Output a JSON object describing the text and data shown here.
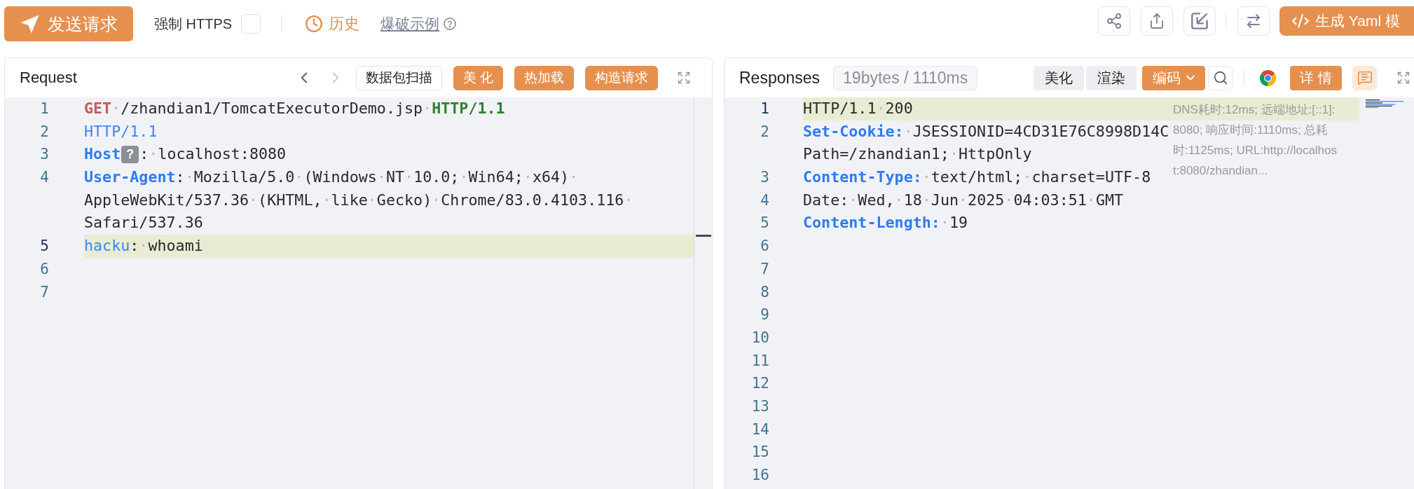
{
  "toolbar": {
    "send_button": {
      "label": "发送请求"
    },
    "force_https": {
      "label": "强制 HTTPS",
      "checked": false
    },
    "history_button": {
      "label": "历史"
    },
    "example_link": {
      "label": "爆破示例"
    },
    "generate_button": {
      "label": "生成 Yaml 模"
    }
  },
  "request": {
    "title": "Request",
    "nav": [
      {
        "kind": "prev",
        "disabled": false
      },
      {
        "kind": "next",
        "disabled": true
      }
    ],
    "buttons": [
      {
        "kind": "outline",
        "label": "数据包扫描"
      },
      {
        "kind": "primary",
        "label": "美 化"
      },
      {
        "kind": "primary",
        "label": "热加载"
      },
      {
        "kind": "primary",
        "label": "构造请求"
      }
    ],
    "lines": [
      {
        "number": "1",
        "active": false,
        "rows": [
          {
            "tokens": [
              {
                "kind": "method",
                "text": "GET"
              },
              {
                "kind": "space",
                "text": "·"
              },
              {
                "kind": "text",
                "text": "/zhandian1/TomcatExecutorDemo.jsp"
              },
              {
                "kind": "space",
                "text": "·"
              },
              {
                "kind": "version",
                "text": "HTTP/1.1"
              }
            ]
          }
        ]
      },
      {
        "number": "2",
        "active": false,
        "rows": [
          {
            "tokens": [
              {
                "kind": "protocol",
                "text": "HTTP/1.1"
              }
            ]
          }
        ]
      },
      {
        "number": "3",
        "active": false,
        "rows": [
          {
            "tokens": [
              {
                "kind": "header",
                "text": "Host"
              },
              {
                "kind": "hint",
                "text": "?"
              },
              {
                "kind": "text",
                "text": ":"
              },
              {
                "kind": "space",
                "text": "·"
              },
              {
                "kind": "text",
                "text": "localhost:8080"
              }
            ]
          }
        ]
      },
      {
        "number": "4",
        "active": false,
        "rows": [
          {
            "tokens": [
              {
                "kind": "header",
                "text": "User-Agent"
              },
              {
                "kind": "text",
                "text": ":"
              },
              {
                "kind": "space",
                "text": "·"
              },
              {
                "kind": "text",
                "text": "Mozilla/5.0"
              },
              {
                "kind": "space",
                "text": "·"
              },
              {
                "kind": "text",
                "text": "(Windows"
              },
              {
                "kind": "space",
                "text": "·"
              },
              {
                "kind": "text",
                "text": "NT"
              },
              {
                "kind": "space",
                "text": "·"
              },
              {
                "kind": "text",
                "text": "10.0;"
              },
              {
                "kind": "space",
                "text": "·"
              },
              {
                "kind": "text",
                "text": "Win64;"
              },
              {
                "kind": "space",
                "text": "·"
              },
              {
                "kind": "text",
                "text": "x64)"
              },
              {
                "kind": "space",
                "text": "·"
              }
            ]
          },
          {
            "tokens": [
              {
                "kind": "text",
                "text": "AppleWebKit/537.36"
              },
              {
                "kind": "space",
                "text": "·"
              },
              {
                "kind": "text",
                "text": "(KHTML,"
              },
              {
                "kind": "space",
                "text": "·"
              },
              {
                "kind": "text",
                "text": "like"
              },
              {
                "kind": "space",
                "text": "·"
              },
              {
                "kind": "text",
                "text": "Gecko)"
              },
              {
                "kind": "space",
                "text": "·"
              },
              {
                "kind": "text",
                "text": "Chrome/83.0.4103.116"
              },
              {
                "kind": "space",
                "text": "·"
              }
            ]
          },
          {
            "tokens": [
              {
                "kind": "text",
                "text": "Safari/537.36"
              }
            ]
          }
        ]
      },
      {
        "number": "5",
        "active": true,
        "rows": [
          {
            "tokens": [
              {
                "kind": "name",
                "text": "hacku"
              },
              {
                "kind": "text",
                "text": ":"
              },
              {
                "kind": "space",
                "text": "·"
              },
              {
                "kind": "text",
                "text": "whoami"
              }
            ]
          }
        ]
      },
      {
        "number": "6",
        "active": false
      },
      {
        "number": "7",
        "active": false
      }
    ]
  },
  "response": {
    "title": "Responses",
    "stats": "19bytes / 1110ms",
    "buttons": [
      {
        "kind": "plain",
        "label": "美化"
      },
      {
        "kind": "plain",
        "label": "渲染"
      },
      {
        "kind": "dropdown",
        "label": "编码"
      }
    ],
    "details_button": {
      "label": "详 情"
    },
    "info_text": "DNS耗时:12ms; 远端地址:[::1]:8080; 响应时间:1110ms; 总耗时:1125ms; URL:http://localhost:8080/zhandian...",
    "lines": [
      {
        "number": "1",
        "active": true,
        "rows": [
          {
            "tokens": [
              {
                "kind": "text",
                "text": "HTTP/1.1"
              },
              {
                "kind": "space",
                "text": "·"
              },
              {
                "kind": "text",
                "text": "200"
              }
            ]
          }
        ]
      },
      {
        "number": "2",
        "active": false,
        "rows": [
          {
            "tokens": [
              {
                "kind": "header",
                "text": "Set-Cookie:"
              },
              {
                "kind": "space",
                "text": "·"
              },
              {
                "kind": "text",
                "text": "JSESSIONID=4CD31E76C8998D14C"
              }
            ]
          },
          {
            "tokens": [
              {
                "kind": "text",
                "text": "Path=/zhandian1;"
              },
              {
                "kind": "space",
                "text": "·"
              },
              {
                "kind": "text",
                "text": "HttpOnly"
              }
            ]
          }
        ]
      },
      {
        "number": "3",
        "active": false,
        "rows": [
          {
            "tokens": [
              {
                "kind": "header",
                "text": "Content-Type:"
              },
              {
                "kind": "space",
                "text": "·"
              },
              {
                "kind": "text",
                "text": "text/html;"
              },
              {
                "kind": "space",
                "text": "·"
              },
              {
                "kind": "text",
                "text": "charset=UTF-8"
              }
            ]
          }
        ]
      },
      {
        "number": "4",
        "active": false,
        "rows": [
          {
            "tokens": [
              {
                "kind": "text",
                "text": "Date:"
              },
              {
                "kind": "space",
                "text": "·"
              },
              {
                "kind": "text",
                "text": "Wed,"
              },
              {
                "kind": "space",
                "text": "·"
              },
              {
                "kind": "text",
                "text": "18"
              },
              {
                "kind": "space",
                "text": "·"
              },
              {
                "kind": "text",
                "text": "Jun"
              },
              {
                "kind": "space",
                "text": "·"
              },
              {
                "kind": "text",
                "text": "2025"
              },
              {
                "kind": "space",
                "text": "·"
              },
              {
                "kind": "text",
                "text": "04:03:51"
              },
              {
                "kind": "space",
                "text": "·"
              },
              {
                "kind": "text",
                "text": "GMT"
              }
            ]
          }
        ]
      },
      {
        "number": "5",
        "active": false,
        "rows": [
          {
            "tokens": [
              {
                "kind": "header",
                "text": "Content-Length:"
              },
              {
                "kind": "space",
                "text": "·"
              },
              {
                "kind": "text",
                "text": "19"
              }
            ]
          }
        ]
      },
      {
        "number": "6",
        "active": false
      },
      {
        "number": "7",
        "active": false
      },
      {
        "number": "8",
        "active": false
      },
      {
        "number": "9",
        "active": false
      },
      {
        "number": "10",
        "active": false
      },
      {
        "number": "11",
        "active": false
      },
      {
        "number": "12",
        "active": false
      },
      {
        "number": "13",
        "active": false
      },
      {
        "number": "14",
        "active": false
      },
      {
        "number": "15",
        "active": false
      },
      {
        "number": "16",
        "active": false
      }
    ]
  }
}
